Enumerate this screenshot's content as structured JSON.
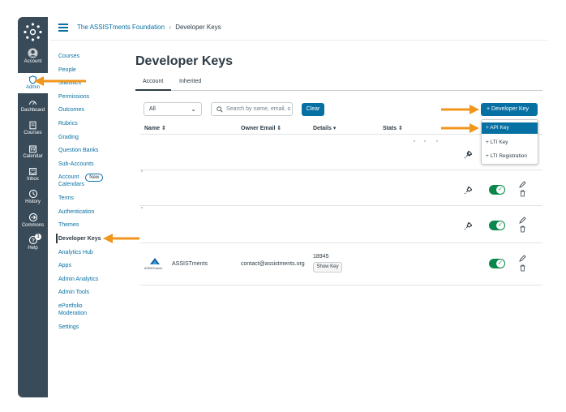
{
  "colors": {
    "nav_bg": "#394b58",
    "link": "#0770a3",
    "primary": "#0770a3",
    "toggle_on": "#0b874b",
    "arrow": "#f0961d"
  },
  "global_nav": {
    "account": "Account",
    "admin": "Admin",
    "dashboard": "Dashboard",
    "courses": "Courses",
    "calendar": "Calendar",
    "inbox": "Inbox",
    "history": "History",
    "commons": "Commons",
    "help": "Help",
    "help_badge": "1"
  },
  "breadcrumb": {
    "root": "The ASSISTments Foundation",
    "sep": "›",
    "current": "Developer Keys"
  },
  "account_nav": {
    "courses": "Courses",
    "people": "People",
    "statistics": "Statistics",
    "permissions": "Permissions",
    "outcomes": "Outcomes",
    "rubrics": "Rubrics",
    "grading": "Grading",
    "question_banks": "Question Banks",
    "sub_accounts": "Sub-Accounts",
    "account_calendars_1": "Account",
    "account_calendars_2": "Calendars",
    "new_badge": "New",
    "terms": "Terms",
    "authentication": "Authentication",
    "themes": "Themes",
    "developer_keys": "Developer Keys",
    "analytics_hub": "Analytics Hub",
    "apps": "Apps",
    "admin_analytics": "Admin Analytics",
    "admin_tools": "Admin Tools",
    "eportfolio_1": "ePortfolio",
    "eportfolio_2": "Moderation",
    "settings": "Settings"
  },
  "page": {
    "title": "Developer Keys",
    "tabs": {
      "account": "Account",
      "inherited": "Inherited"
    },
    "filter_value": "All",
    "search_placeholder": "Search by name, email, o",
    "clear_label": "Clear",
    "add_key_label": "+  Developer Key",
    "columns": {
      "name": "Name ⇕",
      "owner_email": "Owner Email ⇕",
      "details": "Details ▾",
      "stats": "Stats ⇕"
    },
    "dropdown": {
      "api_key": "+  API Key",
      "lti_key": "+  LTI Key",
      "lti_registration": "+  LTI Registration"
    },
    "row_assistments": {
      "name": "ASSISTments",
      "email": "contact@assistments.org",
      "id": "18945",
      "show_key": "Show Key",
      "logo_text": "ASSISTments"
    }
  }
}
